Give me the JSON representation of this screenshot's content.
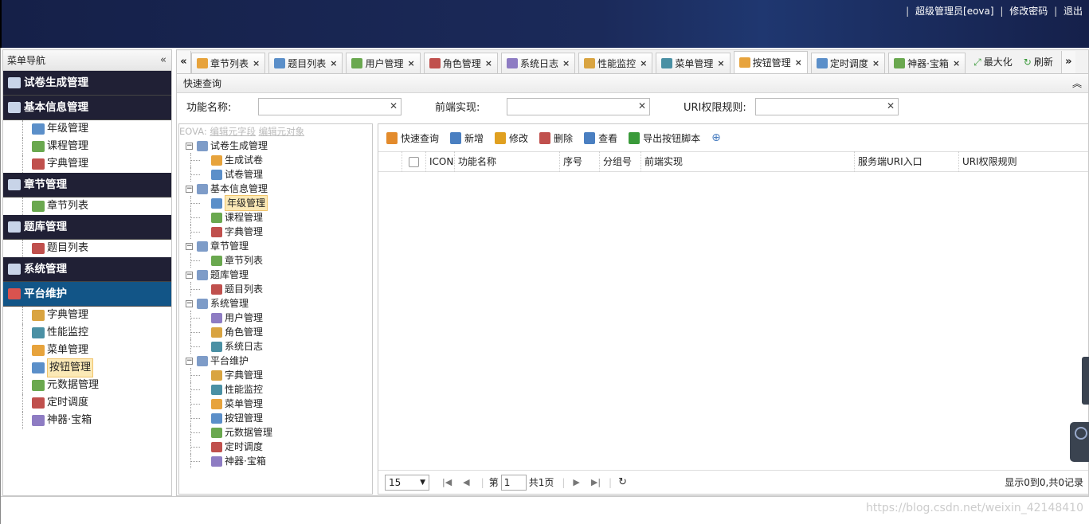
{
  "header": {
    "admin": "超级管理员[eova]",
    "change_pwd": "修改密码",
    "logout": "退出"
  },
  "nav": {
    "title": "菜单导航",
    "groups": [
      {
        "label": "试卷生成管理",
        "items": []
      },
      {
        "label": "基本信息管理",
        "items": [
          "年级管理",
          "课程管理",
          "字典管理"
        ]
      },
      {
        "label": "章节管理",
        "items": [
          "章节列表"
        ]
      },
      {
        "label": "题库管理",
        "items": [
          "题目列表"
        ]
      },
      {
        "label": "系统管理",
        "items": []
      },
      {
        "label": "平台维护",
        "items": [
          "字典管理",
          "性能监控",
          "菜单管理",
          "按钮管理",
          "元数据管理",
          "定时调度",
          "神器·宝箱"
        ]
      }
    ]
  },
  "tabs": [
    "章节列表",
    "题目列表",
    "用户管理",
    "角色管理",
    "系统日志",
    "性能监控",
    "菜单管理",
    "按钮管理",
    "定时调度",
    "神器·宝箱"
  ],
  "tab_actions": {
    "maximize": "最大化",
    "refresh": "刷新"
  },
  "quick": {
    "title": "快速查询",
    "fields": [
      "功能名称:",
      "前端实现:",
      "URI权限规则:"
    ]
  },
  "tree": {
    "links_prefix": "EOVA:",
    "link1": "编辑元字段",
    "link2": "编辑元对象",
    "nodes": [
      {
        "label": "试卷生成管理",
        "children": [
          "生成试卷",
          "试卷管理"
        ]
      },
      {
        "label": "基本信息管理",
        "children": [
          "年级管理",
          "课程管理",
          "字典管理"
        ]
      },
      {
        "label": "章节管理",
        "children": [
          "章节列表"
        ]
      },
      {
        "label": "题库管理",
        "children": [
          "题目列表"
        ]
      },
      {
        "label": "系统管理",
        "children": [
          "用户管理",
          "角色管理",
          "系统日志"
        ]
      },
      {
        "label": "平台维护",
        "children": [
          "字典管理",
          "性能监控",
          "菜单管理",
          "按钮管理",
          "元数据管理",
          "定时调度",
          "神器·宝箱"
        ]
      }
    ]
  },
  "toolbar": [
    "快速查询",
    "新增",
    "修改",
    "删除",
    "查看",
    "导出按钮脚本"
  ],
  "columns": [
    "ICON",
    "功能名称",
    "序号",
    "分组号",
    "前端实现",
    "服务端URI入口",
    "URI权限规则"
  ],
  "pager": {
    "size": "15",
    "page_prefix": "第",
    "page": "1",
    "total": "共1页",
    "info": "显示0到0,共0记录"
  },
  "watermark": "https://blog.csdn.net/weixin_42148410"
}
